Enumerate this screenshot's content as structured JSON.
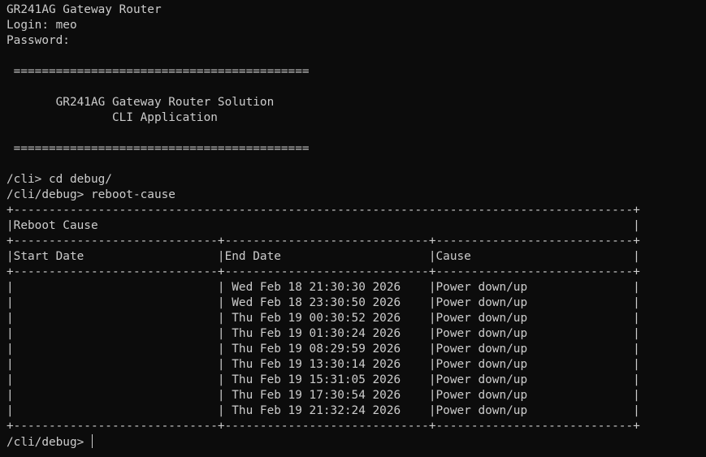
{
  "terminal": {
    "lines": [
      "GR241AG Gateway Router",
      "Login: meo",
      "Password:",
      "",
      " ==========================================",
      "",
      "       GR241AG Gateway Router Solution",
      "               CLI Application",
      "",
      " ==========================================",
      "",
      "/cli> cd debug/",
      "/cli/debug> reboot-cause",
      "+----------------------------------------------------------------------------------------+",
      "|Reboot Cause                                                                            |",
      "+-----------------------------+-----------------------------+----------------------------+",
      "|Start Date                   |End Date                     |Cause                       |",
      "+-----------------------------+-----------------------------+----------------------------+",
      "|                             | Wed Feb 18 21:30:30 2026    |Power down/up               |",
      "|                             | Wed Feb 18 23:30:50 2026    |Power down/up               |",
      "|                             | Thu Feb 19 00:30:52 2026    |Power down/up               |",
      "|                             | Thu Feb 19 01:30:24 2026    |Power down/up               |",
      "|                             | Thu Feb 19 08:29:59 2026    |Power down/up               |",
      "|                             | Thu Feb 19 13:30:14 2026    |Power down/up               |",
      "|                             | Thu Feb 19 15:31:05 2026    |Power down/up               |",
      "|                             | Thu Feb 19 17:30:54 2026    |Power down/up               |",
      "|                             | Thu Feb 19 21:32:24 2026    |Power down/up               |",
      "+-----------------------------+-----------------------------+----------------------------+"
    ],
    "prompt": "/cli/debug> "
  }
}
